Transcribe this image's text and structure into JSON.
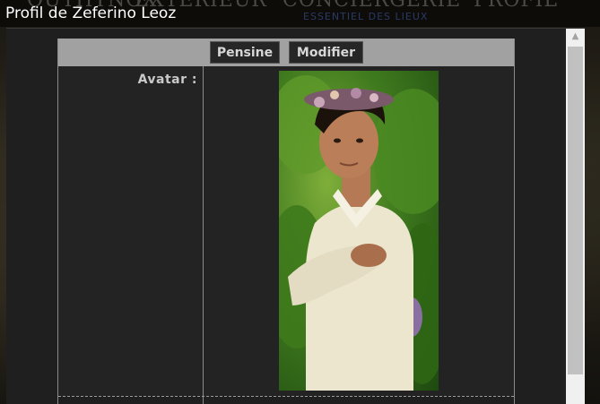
{
  "background_nav": {
    "items": [
      "OUTHYNOX",
      "EXTERIEUR",
      "CONCIERGERIE",
      "PROFIL"
    ],
    "subtitle": "ESSENTIEL DES LIEUX"
  },
  "modal": {
    "title": "Profil de Zeferino Leoz"
  },
  "toolbar": {
    "pensine_label": "Pensine",
    "modifier_label": "Modifier"
  },
  "profile": {
    "avatar_label": "Avatar :"
  },
  "colors": {
    "modal_bg": "#1f1f1f",
    "toolbar_bg": "#a1a1a1",
    "button_bg": "#262626",
    "button_text": "#d7d7d7",
    "title_text": "#ffffff"
  },
  "icons": {
    "scroll_up": "triangle-up-icon"
  }
}
